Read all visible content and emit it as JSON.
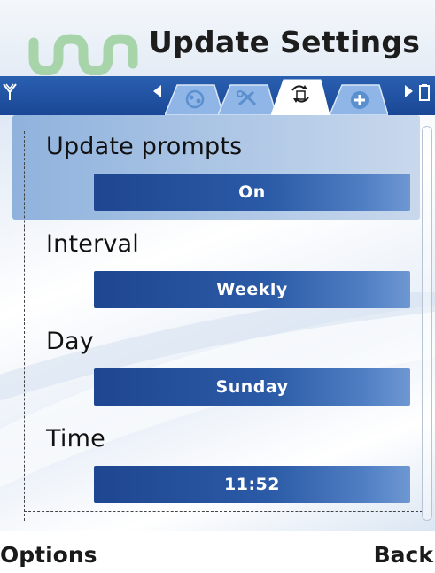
{
  "header": {
    "title": "Update Settings",
    "logo_icon": "umu-logo-icon"
  },
  "tabstrip": {
    "tabs": [
      {
        "icon": "sync-icon"
      },
      {
        "icon": "tools-icon"
      },
      {
        "icon": "update-icon",
        "active": true
      },
      {
        "icon": "add-icon"
      }
    ]
  },
  "settings": [
    {
      "label": "Update prompts",
      "value": "On"
    },
    {
      "label": "Interval",
      "value": "Weekly"
    },
    {
      "label": "Day",
      "value": "Sunday"
    },
    {
      "label": "Time",
      "value": "11:52"
    }
  ],
  "softkeys": {
    "left": "Options",
    "right": "Back"
  },
  "colors": {
    "tab_bar": "#1a4796",
    "value_box": "#2b5aa6",
    "highlight": "#8fb2dd"
  }
}
